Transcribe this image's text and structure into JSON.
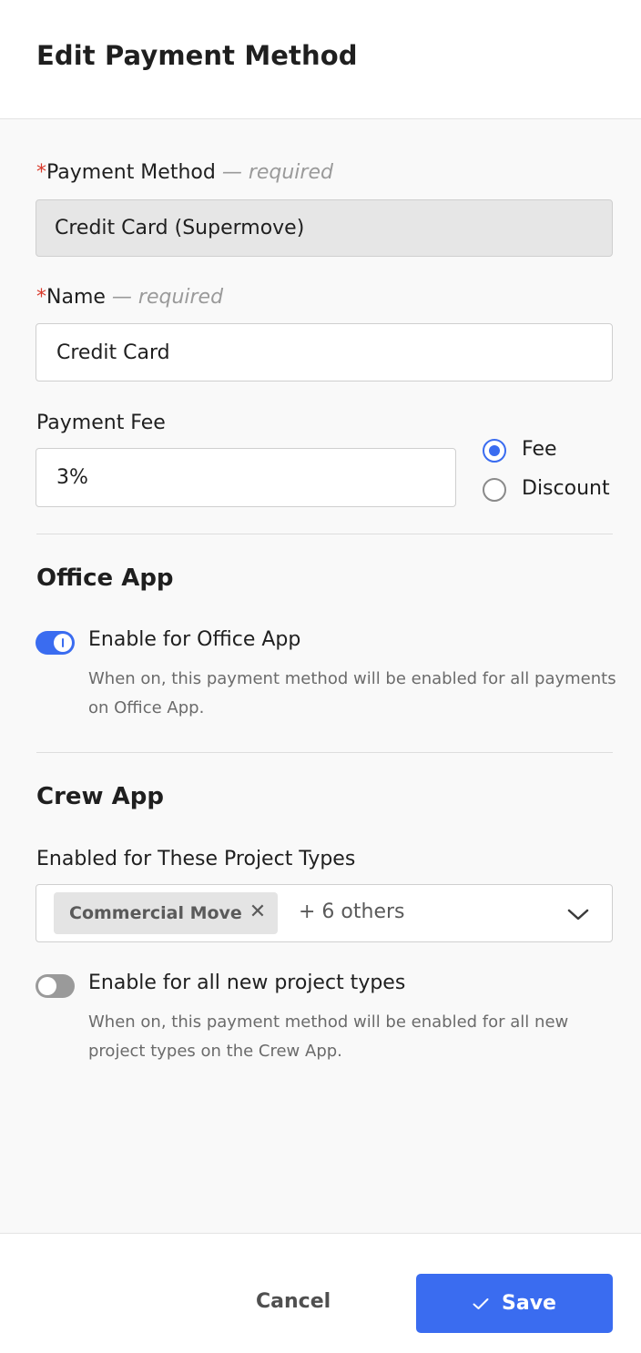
{
  "header": {
    "title": "Edit Payment Method"
  },
  "form": {
    "payment_method": {
      "label": "Payment Method",
      "required_marker": "*",
      "required_text": "— required",
      "value": "Credit Card (Supermove)"
    },
    "name": {
      "label": "Name",
      "required_marker": "*",
      "required_text": "— required",
      "value": "Credit Card"
    },
    "payment_fee": {
      "label": "Payment Fee",
      "value": "3%",
      "options": [
        {
          "label": "Fee",
          "selected": true
        },
        {
          "label": "Discount",
          "selected": false
        }
      ]
    }
  },
  "office_app": {
    "title": "Office App",
    "toggle_label": "Enable for Office App",
    "toggle_on": true,
    "helper_text": "When on, this payment method will be enabled for all payments on Office App."
  },
  "crew_app": {
    "title": "Crew App",
    "project_types_label": "Enabled for These Project Types",
    "selected_chip": "Commercial Move",
    "more_text": "+ 6 others",
    "toggle_label": "Enable for all new project types",
    "toggle_on": false,
    "helper_text": "When on, this payment method will be enabled for all new project types on the Crew App."
  },
  "footer": {
    "cancel_label": "Cancel",
    "save_label": "Save"
  },
  "colors": {
    "accent": "#3a6cf0",
    "required": "#d93a2b"
  }
}
